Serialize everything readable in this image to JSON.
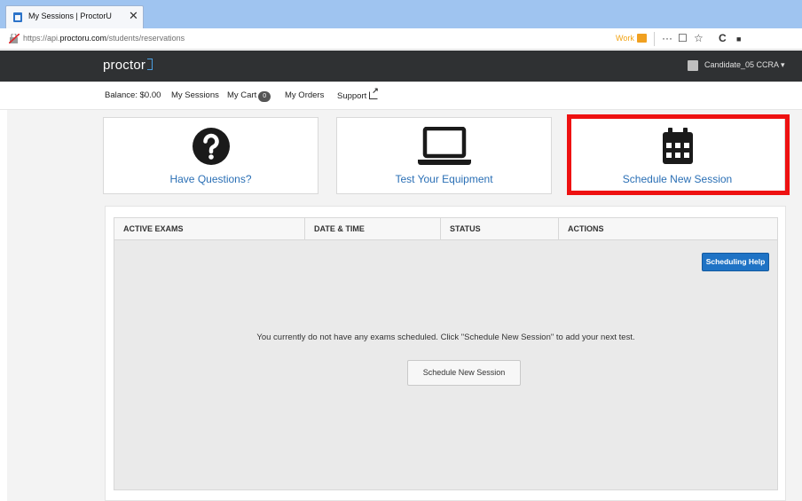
{
  "browser": {
    "tab_title": "My Sessions | ProctorU",
    "tab_close": "✕",
    "url_prefix": "https://api.",
    "url_domain": "proctoru.com",
    "url_path": "/students/reservations",
    "container_label": "Work",
    "toolbar_icons": {
      "more": "···",
      "pocket": "☐",
      "bookmark": "☆",
      "reload": "C",
      "extension": "■"
    }
  },
  "header": {
    "logo": "proctor",
    "user_name": "Candidate_05 CCRA ▾"
  },
  "subnav": {
    "balance": "Balance: $0.00",
    "my_sessions": "My Sessions",
    "my_cart": "My Cart",
    "cart_count": "0",
    "my_orders": "My Orders",
    "support": "Support"
  },
  "cards": [
    {
      "label": "Have Questions?",
      "icon": "question-circle-icon"
    },
    {
      "label": "Test Your Equipment",
      "icon": "laptop-icon"
    },
    {
      "label": "Schedule New Session",
      "icon": "calendar-icon"
    }
  ],
  "table": {
    "columns": [
      "ACTIVE EXAMS",
      "DATE & TIME",
      "STATUS",
      "ACTIONS"
    ],
    "help_button": "Scheduling Help",
    "empty_message": "You currently do not have any exams scheduled. Click \"Schedule New Session\" to add your next test.",
    "schedule_button": "Schedule New Session"
  },
  "colors": {
    "accent": "#2a6fb5",
    "nav_bg": "#2f3133",
    "highlight": "#ee1111",
    "primary_button": "#1f73c5"
  }
}
